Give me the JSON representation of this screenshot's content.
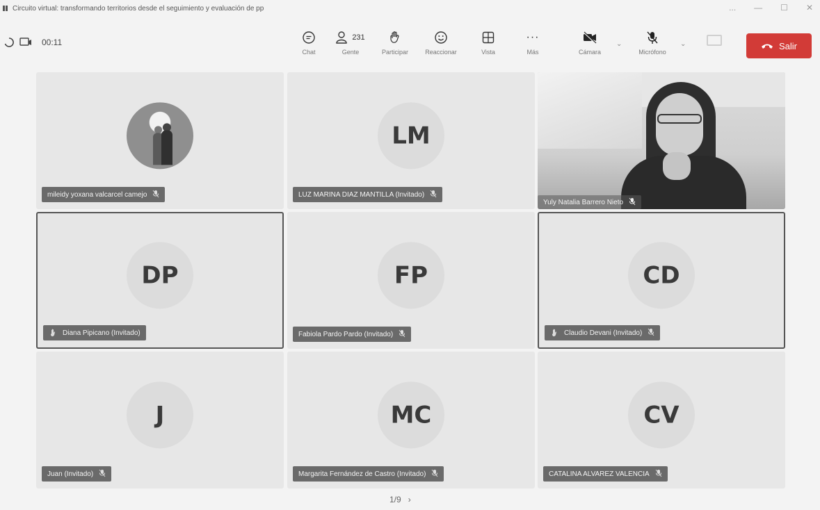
{
  "window": {
    "title": "Circuito virtual: transformando territorios desde el seguimiento y evaluación de pp",
    "controls": [
      "...",
      "—",
      "☐",
      "✕"
    ]
  },
  "toolbar": {
    "timer": "00:11",
    "chat_label": "Chat",
    "people_count": "231",
    "people_label": "Gente",
    "raise_hand_label": "Participar",
    "react_label": "Reaccionar",
    "view_label": "Vista",
    "more_label": "Más",
    "more_glyph": "···",
    "camera_label": "Cámara",
    "mic_label": "Micrófono",
    "leave_label": "Salir",
    "icons": {
      "chat": "chat-icon",
      "people": "people-icon",
      "raise_hand": "hand-icon",
      "react": "smiley-icon",
      "view": "grid-icon",
      "camera": "camera-off-icon",
      "mic": "mic-off-icon",
      "leave": "phone-hangup-icon"
    }
  },
  "tiles": [
    {
      "initials": "",
      "name": "mileidy yoxana valcarcel camejo",
      "muted": true,
      "photo": true
    },
    {
      "initials": "LM",
      "name": "LUZ MARINA DIAZ MANTILLA (Invitado)",
      "muted": true
    },
    {
      "initials": "",
      "name": "Yuly Natalia Barrero Nieto",
      "muted": true,
      "video": true
    },
    {
      "initials": "DP",
      "name": "Diana Pipicano (Invitado)",
      "hand_raised": true,
      "highlight": true
    },
    {
      "initials": "FP",
      "name": "Fabiola Pardo Pardo (Invitado)",
      "muted": true
    },
    {
      "initials": "CD",
      "name": "Claudio Devani (Invitado)",
      "hand_raised": true,
      "muted": true,
      "highlight": true
    },
    {
      "initials": "J",
      "name": "Juan (Invitado)",
      "muted": true
    },
    {
      "initials": "MC",
      "name": "Margarita Fernández de Castro (Invitado)",
      "muted": true
    },
    {
      "initials": "CV",
      "name": "CATALINA ALVAREZ VALENCIA",
      "muted": true
    }
  ],
  "pager": {
    "page": "1/9",
    "next": "›"
  },
  "colors": {
    "leave": "#d23b37",
    "tile_bg": "#e7e7e7",
    "name_tag": "#6a6a6a"
  }
}
